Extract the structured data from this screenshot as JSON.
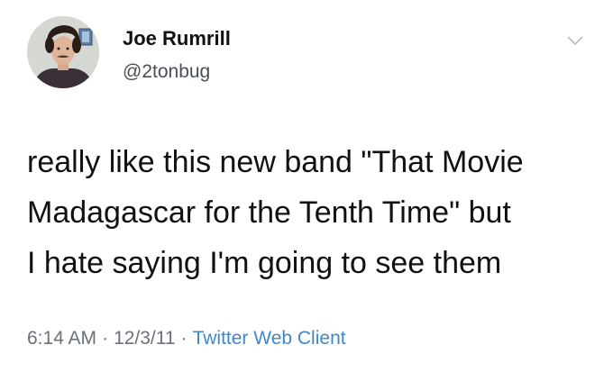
{
  "author": {
    "name": "Joe Rumrill",
    "handle": "@2tonbug",
    "avatar_icon": "profile-photo"
  },
  "menu_icon": "chevron-down-icon",
  "tweet": {
    "lines": [
      "really like this new band \"That Movie",
      "Madagascar for the Tenth Time\" but",
      "I hate saying I'm going to see them"
    ]
  },
  "meta": {
    "time": "6:14 AM",
    "separator": "·",
    "date": "12/3/11",
    "client": "Twitter Web Client"
  },
  "colors": {
    "text": "#111111",
    "secondary": "#6a7178",
    "link": "#3f87c7",
    "background": "#ffffff"
  }
}
